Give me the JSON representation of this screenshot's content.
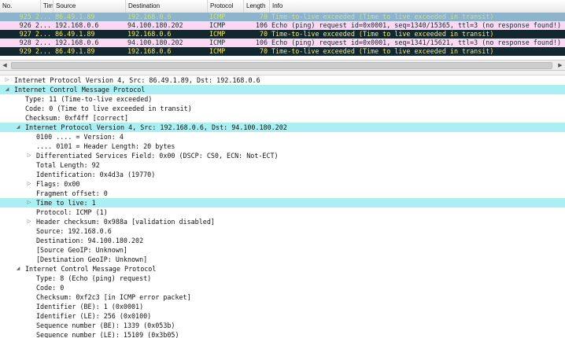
{
  "packet_list": {
    "columns": [
      "No.",
      "Time",
      "Source",
      "Destination",
      "Protocol",
      "Length",
      "Info"
    ],
    "rows": [
      {
        "no": "925 2...",
        "src": "86.49.1.89",
        "dst": "192.168.0.6",
        "proto": "ICMP",
        "len": "70",
        "info": "Time-to-live exceeded (Time to live exceeded in transit)",
        "kind": "ttl selected"
      },
      {
        "no": "926 2...",
        "src": "192.168.0.6",
        "dst": "94.100.180.202",
        "proto": "ICMP",
        "len": "106",
        "info": "Echo (ping) request  id=0x0001, seq=1340/15365, ttl=3 (no response found!)",
        "kind": "echo"
      },
      {
        "no": "927 2...",
        "src": "86.49.1.89",
        "dst": "192.168.0.6",
        "proto": "ICMP",
        "len": "70",
        "info": "Time-to-live exceeded (Time to live exceeded in transit)",
        "kind": "ttl"
      },
      {
        "no": "928 2...",
        "src": "192.168.0.6",
        "dst": "94.100.180.202",
        "proto": "ICMP",
        "len": "106",
        "info": "Echo (ping) request  id=0x0001, seq=1341/15621, ttl=3 (no response found!)",
        "kind": "echo"
      },
      {
        "no": "929 2...",
        "src": "86.49.1.89",
        "dst": "192.168.0.6",
        "proto": "ICMP",
        "len": "70",
        "info": "Time-to-live exceeded (Time to live exceeded in transit)",
        "kind": "ttl"
      }
    ]
  },
  "details": [
    {
      "text": "Internet Protocol Version 4, Src: 86.49.1.89, Dst: 192.168.0.6",
      "indent": 0,
      "toggle": "collapsed",
      "hl": false
    },
    {
      "text": "Internet Control Message Protocol",
      "indent": 0,
      "toggle": "expanded",
      "hl": true
    },
    {
      "text": "Type: 11 (Time-to-live exceeded)",
      "indent": 1,
      "toggle": "none",
      "hl": false
    },
    {
      "text": "Code: 0 (Time to live exceeded in transit)",
      "indent": 1,
      "toggle": "none",
      "hl": false
    },
    {
      "text": "Checksum: 0xf4ff [correct]",
      "indent": 1,
      "toggle": "none",
      "hl": false
    },
    {
      "text": "Internet Protocol Version 4, Src: 192.168.0.6, Dst: 94.100.180.202",
      "indent": 1,
      "toggle": "expanded",
      "hl": true
    },
    {
      "text": "0100 .... = Version: 4",
      "indent": 2,
      "toggle": "none",
      "hl": false
    },
    {
      "text": ".... 0101 = Header Length: 20 bytes",
      "indent": 2,
      "toggle": "none",
      "hl": false
    },
    {
      "text": "Differentiated Services Field: 0x00 (DSCP: CS0, ECN: Not-ECT)",
      "indent": 2,
      "toggle": "collapsed",
      "hl": false
    },
    {
      "text": "Total Length: 92",
      "indent": 2,
      "toggle": "none",
      "hl": false
    },
    {
      "text": "Identification: 0x4d3a (19770)",
      "indent": 2,
      "toggle": "none",
      "hl": false
    },
    {
      "text": "Flags: 0x00",
      "indent": 2,
      "toggle": "collapsed",
      "hl": false
    },
    {
      "text": "Fragment offset: 0",
      "indent": 2,
      "toggle": "none",
      "hl": false
    },
    {
      "text": "Time to live: 1",
      "indent": 2,
      "toggle": "collapsed",
      "hl": true
    },
    {
      "text": "Protocol: ICMP (1)",
      "indent": 2,
      "toggle": "none",
      "hl": false
    },
    {
      "text": "Header checksum: 0x988a [validation disabled]",
      "indent": 2,
      "toggle": "collapsed",
      "hl": false
    },
    {
      "text": "Source: 192.168.0.6",
      "indent": 2,
      "toggle": "none",
      "hl": false
    },
    {
      "text": "Destination: 94.100.180.202",
      "indent": 2,
      "toggle": "none",
      "hl": false
    },
    {
      "text": "[Source GeoIP: Unknown]",
      "indent": 2,
      "toggle": "none",
      "hl": false
    },
    {
      "text": "[Destination GeoIP: Unknown]",
      "indent": 2,
      "toggle": "none",
      "hl": false
    },
    {
      "text": "Internet Control Message Protocol",
      "indent": 1,
      "toggle": "expanded",
      "hl": false
    },
    {
      "text": "Type: 8 (Echo (ping) request)",
      "indent": 2,
      "toggle": "none",
      "hl": false
    },
    {
      "text": "Code: 0",
      "indent": 2,
      "toggle": "none",
      "hl": false
    },
    {
      "text": "Checksum: 0xf2c3 [in ICMP error packet]",
      "indent": 2,
      "toggle": "none",
      "hl": false
    },
    {
      "text": "Identifier (BE): 1 (0x0001)",
      "indent": 2,
      "toggle": "none",
      "hl": false
    },
    {
      "text": "Identifier (LE): 256 (0x0100)",
      "indent": 2,
      "toggle": "none",
      "hl": false
    },
    {
      "text": "Sequence number (BE): 1339 (0x053b)",
      "indent": 2,
      "toggle": "none",
      "hl": false
    },
    {
      "text": "Sequence number (LE): 15109 (0x3b05)",
      "indent": 2,
      "toggle": "none",
      "hl": false
    }
  ],
  "icons": {
    "collapsed": "triangle-right-icon",
    "expanded": "triangle-down-icon"
  }
}
